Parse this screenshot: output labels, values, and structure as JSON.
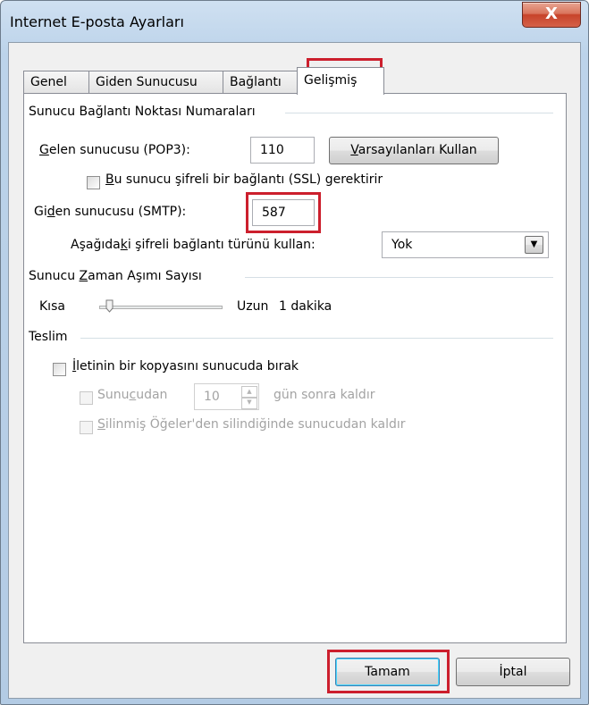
{
  "window": {
    "title": "Internet E-posta Ayarları",
    "close_glyph": "X"
  },
  "tabs": [
    {
      "label": "Genel"
    },
    {
      "label": "Giden Sunucusu"
    },
    {
      "label": "Bağlantı"
    },
    {
      "label": "Gelişmiş",
      "active": true
    }
  ],
  "ports": {
    "group_label": "Sunucu Bağlantı Noktası Numaraları",
    "incoming_label_pre": "G",
    "incoming_label_rest": "elen sunucusu (POP3):",
    "incoming_value": "110",
    "defaults_button_pre": "V",
    "defaults_button_rest": "arsayılanları Kullan",
    "ssl_pre": "B",
    "ssl_rest": "u sunucu şifreli bir bağlantı (SSL) gerektirir",
    "outgoing_label_a": "Gi",
    "outgoing_label_u": "d",
    "outgoing_label_b": "en sunucusu (SMTP):",
    "outgoing_value": "587",
    "encryption_label_a": "Aşağıda",
    "encryption_label_u": "k",
    "encryption_label_b": "i şifreli bağlantı türünü kullan:",
    "encryption_value": "Yok"
  },
  "timeout": {
    "group_label_a": "Sunucu ",
    "group_label_u": "Z",
    "group_label_b": "aman Aşımı Sayısı",
    "short_label": "Kısa",
    "long_label": "Uzun",
    "value_text": "1 dakika",
    "slider_level": 0.05
  },
  "delivery": {
    "group_label": "Teslim",
    "leave_copy_u": "İ",
    "leave_copy_rest": "letinin bir kopyasını sunucuda bırak",
    "remove_after_a": "Sunu",
    "remove_after_u": "c",
    "remove_after_b": "udan",
    "days_value": "10",
    "days_suffix": "gün sonra kaldır",
    "remove_deleted_u": "S",
    "remove_deleted_rest": "ilinmiş Öğeler'den silindiğinde sunucudan kaldır"
  },
  "footer": {
    "ok_label": "Tamam",
    "cancel_label": "İptal"
  },
  "colors": {
    "highlight": "#cc1f2d",
    "titlebar": "#bcd3ea",
    "close": "#c7432a"
  }
}
